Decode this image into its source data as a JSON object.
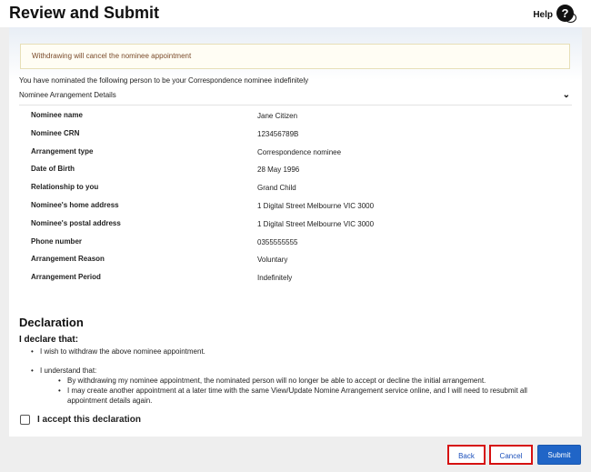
{
  "header": {
    "title": "Review and Submit",
    "help_label": "Help",
    "help_icon_glyph": "?"
  },
  "notice": "Withdrawing will cancel the nominee appointment",
  "intro": "You have nominated the following person to be your Correspondence nominee indefinitely",
  "accordion": {
    "title": "Nominee Arrangement Details",
    "icon": "chevron-down-icon"
  },
  "details": [
    {
      "label": "Nominee name",
      "value": "Jane Citizen"
    },
    {
      "label": "Nominee CRN",
      "value": "123456789B"
    },
    {
      "label": "Arrangement type",
      "value": "Correspondence nominee"
    },
    {
      "label": "Date of Birth",
      "value": "28 May 1996"
    },
    {
      "label": "Relationship to you",
      "value": "Grand Child"
    },
    {
      "label": "Nominee's home address",
      "value": "1 Digital Street Melbourne VIC 3000"
    },
    {
      "label": "Nominee's postal address",
      "value": "1 Digital Street Melbourne VIC 3000"
    },
    {
      "label": "Phone number",
      "value": "0355555555"
    },
    {
      "label": "Arrangement Reason",
      "value": "Voluntary"
    },
    {
      "label": "Arrangement Period",
      "value": "Indefinitely"
    }
  ],
  "declaration": {
    "title": "Declaration",
    "intro": "I declare that:",
    "items": [
      "I wish to withdraw the above nominee appointment.",
      "I understand that:"
    ],
    "sub_items": [
      "By withdrawing my nominee appointment, the nominated person will no longer be able to accept or decline the initial arrangement.",
      "I may create another appointment at a later time with the same View/Update Nomine Arrangement service online, and I will need to resubmit all appointment details again."
    ],
    "accept_label": "I accept this declaration",
    "accepted": false
  },
  "buttons": {
    "back": "Back",
    "cancel": "Cancel",
    "submit": "Submit"
  },
  "colors": {
    "primary": "#2065c7",
    "highlight_border": "#d61111",
    "notice_text": "#7a4b2a"
  }
}
